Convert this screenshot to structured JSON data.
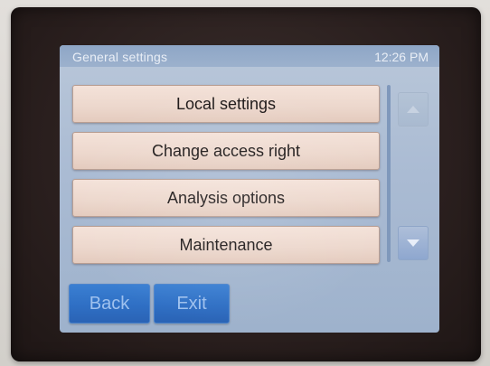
{
  "window": {
    "title": "General settings",
    "clock": "12:26 PM"
  },
  "menu": {
    "items": [
      {
        "label": "Local settings"
      },
      {
        "label": "Change access right"
      },
      {
        "label": "Analysis options"
      },
      {
        "label": "Maintenance"
      }
    ]
  },
  "scroll": {
    "up_icon": "chevron-up-icon",
    "down_icon": "chevron-down-icon"
  },
  "footer": {
    "back_label": "Back",
    "exit_label": "Exit"
  },
  "colors": {
    "screen_bg": "#aabbd3",
    "button_bg": "#ecd7cc",
    "nav_button_bg": "#2f6fc4",
    "nav_button_text": "#9fc1ee"
  }
}
